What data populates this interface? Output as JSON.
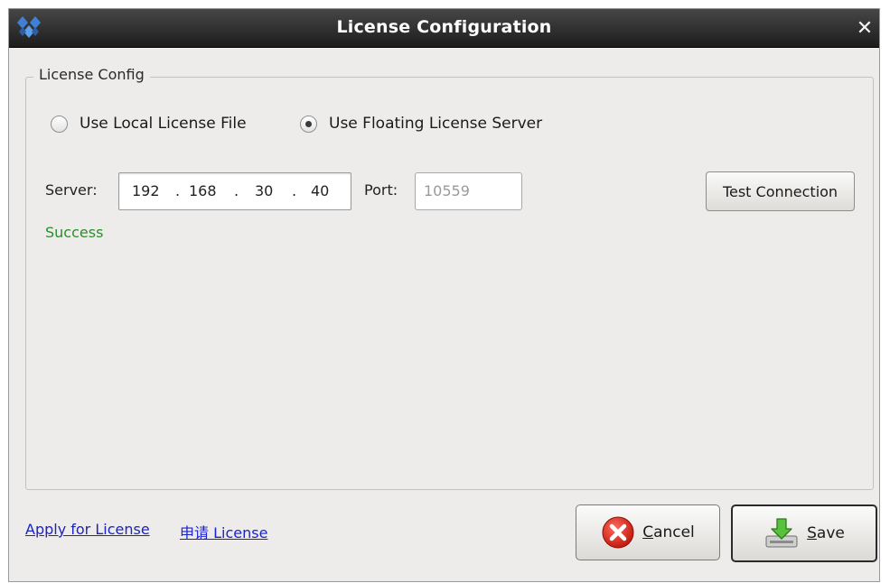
{
  "window": {
    "title": "License Configuration",
    "close_glyph": "✕"
  },
  "group": {
    "title": "License Config"
  },
  "mode": {
    "local_label": "Use Local License File",
    "floating_label": "Use Floating License Server",
    "selected": "floating"
  },
  "server": {
    "label": "Server:",
    "ip": [
      "192",
      "168",
      "30",
      "40"
    ],
    "dot": "."
  },
  "port": {
    "label": "Port:",
    "value": "10559"
  },
  "test_button": {
    "label": "Test Connection"
  },
  "status": {
    "text": "Success",
    "color": "#2e8b2e"
  },
  "links": {
    "apply_en": "Apply for License",
    "apply_cn": "申请 License"
  },
  "buttons": {
    "cancel_mnemonic": "C",
    "cancel_rest": "ancel",
    "save_mnemonic": "S",
    "save_rest": "ave"
  },
  "icons": {
    "app": "app-logo-icon",
    "cancel": "cancel-x-icon",
    "save": "save-download-icon"
  }
}
